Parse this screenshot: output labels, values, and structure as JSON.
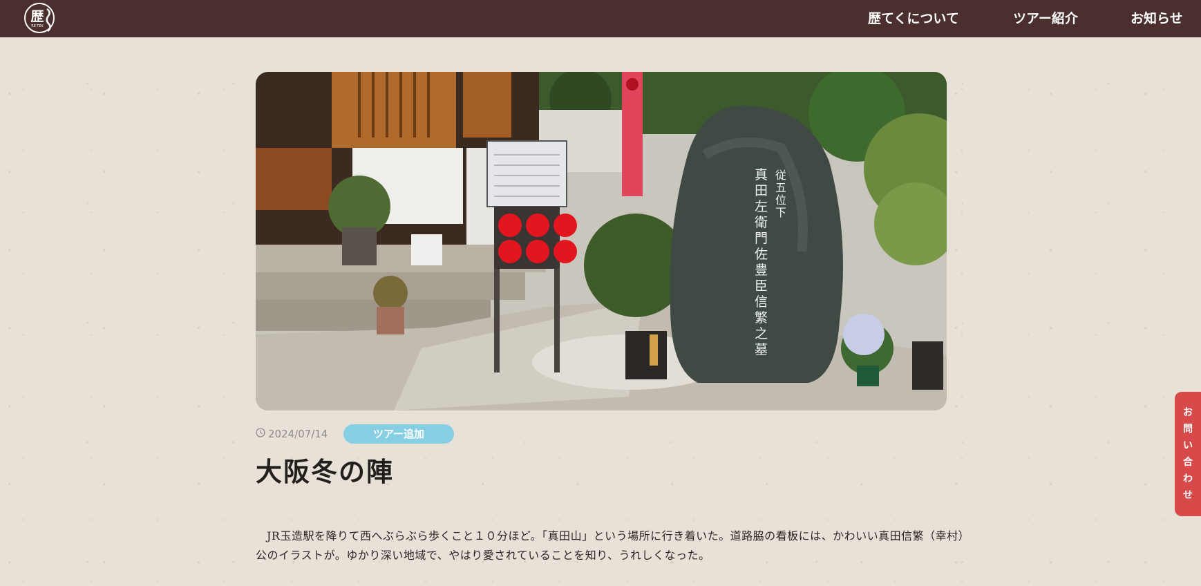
{
  "header": {
    "logo_text": "歴",
    "logo_sub": "RE-TEK",
    "nav": [
      {
        "label": "歴てくについて"
      },
      {
        "label": "ツアー紹介"
      },
      {
        "label": "お知らせ"
      }
    ]
  },
  "article": {
    "date": "2024/07/14",
    "tag": "ツアー追加",
    "title": "大阪冬の陣",
    "body": [
      "JR玉造駅を降りて西へぶらぶら歩くこと１０分ほど。「真田山」という場所に行き着いた。道路脇の看板には、かわいい真田信繁（幸村）公のイラストが。ゆかり深い地域で、やはり愛されていることを知り、うれしくなった。"
    ],
    "hero_stone_text": "従五位下 真田左衛門佐豊臣信繁之墓"
  },
  "contact_tab": {
    "chars": [
      "お",
      "問",
      "い",
      "合",
      "わ",
      "せ"
    ]
  },
  "colors": {
    "header_bg": "#4b2e2e",
    "page_bg": "#e8e1d7",
    "tag_bg": "#86cfe2",
    "contact_bg": "#d84a4a"
  }
}
